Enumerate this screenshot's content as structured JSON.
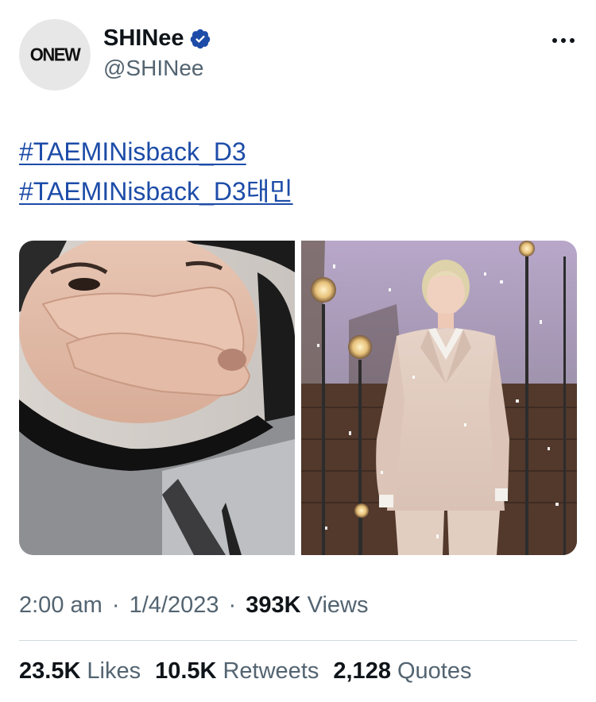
{
  "author": {
    "avatar_text": "ONEW",
    "display_name": "SHINee",
    "handle": "@SHINee",
    "verified": true
  },
  "tweet": {
    "hashtags": [
      "#TAEMINisback_D3",
      "#TAEMINisback_D3태민"
    ]
  },
  "media": [
    {
      "description": "selfie peace sign"
    },
    {
      "description": "stage performer in beige suit"
    }
  ],
  "meta": {
    "time": "2:00 am",
    "date": "1/4/2023",
    "views_count": "393K",
    "views_label": "Views"
  },
  "stats": {
    "likes_count": "23.5K",
    "likes_label": "Likes",
    "retweets_count": "10.5K",
    "retweets_label": "Retweets",
    "quotes_count": "2,128",
    "quotes_label": "Quotes"
  },
  "colors": {
    "link": "#1d4ca8",
    "verified": "#1d9bf0",
    "muted": "#536471",
    "text": "#0f1419"
  }
}
